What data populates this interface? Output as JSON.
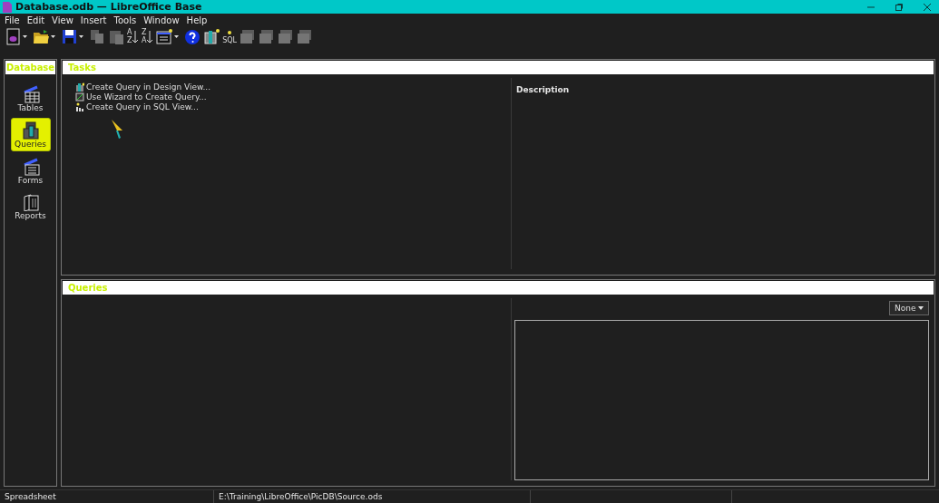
{
  "window": {
    "title": "Database.odb — LibreOffice Base"
  },
  "menu": [
    "File",
    "Edit",
    "View",
    "Insert",
    "Tools",
    "Window",
    "Help"
  ],
  "toolbar": [
    {
      "kind": "new",
      "dropdown": true,
      "disabled": false
    },
    {
      "kind": "open",
      "dropdown": true,
      "disabled": false
    },
    {
      "kind": "save",
      "dropdown": true,
      "disabled": false
    },
    {
      "kind": "copy",
      "dropdown": false,
      "disabled": true
    },
    {
      "kind": "paste",
      "dropdown": false,
      "disabled": true
    },
    {
      "kind": "sort-asc",
      "label": "A Z",
      "dropdown": false,
      "disabled": false
    },
    {
      "kind": "sort-desc",
      "label": "Z A",
      "dropdown": false,
      "disabled": false
    },
    {
      "kind": "form",
      "dropdown": true,
      "disabled": false
    },
    {
      "kind": "help",
      "dropdown": false,
      "disabled": false
    },
    {
      "kind": "design",
      "dropdown": false,
      "disabled": false
    },
    {
      "kind": "sql",
      "label": "SQL",
      "dropdown": false,
      "disabled": false
    },
    {
      "kind": "object",
      "dropdown": false,
      "disabled": true
    },
    {
      "kind": "object",
      "dropdown": false,
      "disabled": true
    },
    {
      "kind": "object",
      "dropdown": false,
      "disabled": true
    },
    {
      "kind": "object",
      "dropdown": false,
      "disabled": true
    }
  ],
  "sidebar": {
    "title": "Database",
    "items": [
      {
        "label": "Tables",
        "kind": "tables",
        "selected": false
      },
      {
        "label": "Queries",
        "kind": "queries",
        "selected": true
      },
      {
        "label": "Forms",
        "kind": "forms",
        "selected": false
      },
      {
        "label": "Reports",
        "kind": "reports",
        "selected": false
      }
    ]
  },
  "tasks": {
    "title": "Tasks",
    "items": [
      {
        "label": "Create Query in Design View...",
        "kind": "design"
      },
      {
        "label": "Use Wizard to Create Query...",
        "kind": "wizard"
      },
      {
        "label": "Create Query in SQL View...",
        "kind": "sql"
      }
    ],
    "description_title": "Description"
  },
  "queries": {
    "title": "Queries",
    "preview": "None"
  },
  "status_bar": [
    "Spreadsheet",
    "E:\\Training\\LibreOffice\\PicDB\\Source.ods"
  ]
}
